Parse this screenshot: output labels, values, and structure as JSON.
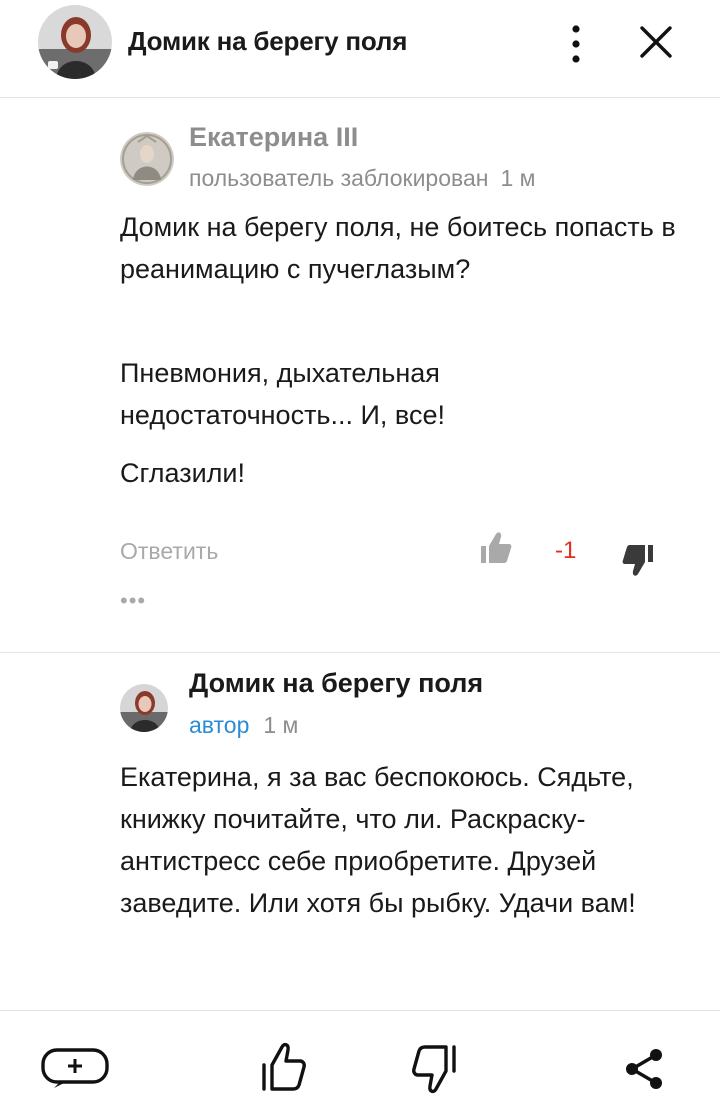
{
  "header": {
    "title": "Домик на берегу поля",
    "avatar_icon": "user-avatar-photo",
    "menu_icon": "more-vertical-icon",
    "close_icon": "close-icon"
  },
  "comments": [
    {
      "author": "Екатерина III",
      "status": "пользователь заблокирован",
      "time": "1 м",
      "paragraphs": [
        "Домик на берегу поля, не боитесь попасть в реанимацию с пучеглазым?",
        "Пневмония, дыхательная недостаточность... И, все!",
        "Сглазили!"
      ],
      "reply_label": "Ответить",
      "score": "-1",
      "more_label": "•••"
    },
    {
      "author": "Домик на берегу поля",
      "role": "автор",
      "time": "1 м",
      "paragraphs": [
        "Екатерина, я за вас беспокоюсь. Сядьте, книжку почитайте, что ли. Раскраску-антистресс себе приобретите. Друзей заведите. Или хотя бы рыбку. Удачи вам!"
      ]
    }
  ],
  "bottom_bar": {
    "add_comment_icon": "add-comment-icon",
    "like_icon": "thumbs-up-icon",
    "dislike_icon": "thumbs-down-icon",
    "share_icon": "share-icon"
  },
  "colors": {
    "accent_blue": "#2a8bd6",
    "negative_red": "#e0301e",
    "muted_gray": "#8d8d8d"
  }
}
